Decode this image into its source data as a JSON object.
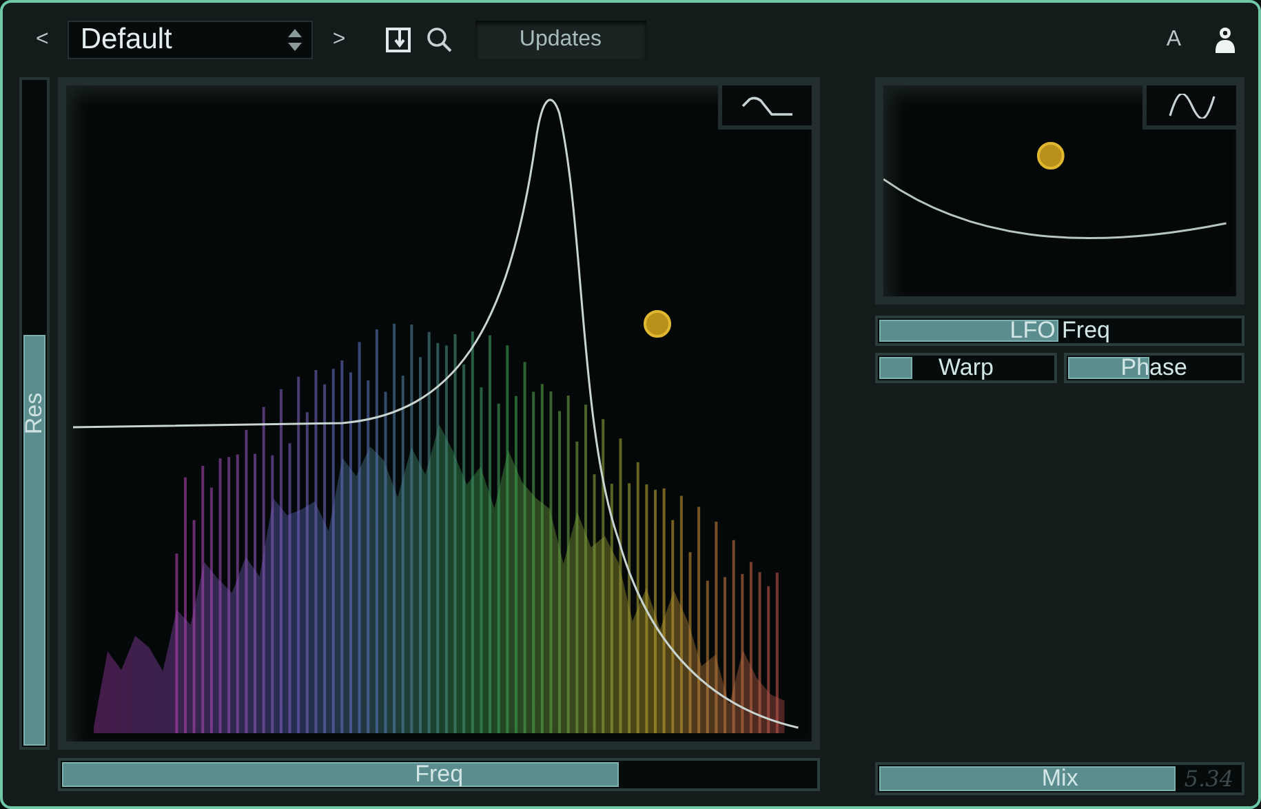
{
  "preset_bar": {
    "prev": "<",
    "name": "Default",
    "next": ">",
    "updates_button": "Updates",
    "a_label": "A"
  },
  "filter_display": {
    "res_slider": {
      "label": "Res",
      "level": 0.62
    },
    "freq_slider": {
      "label": "Freq",
      "level": 0.74
    }
  },
  "lfo_panel": {
    "lfo_freq_slider": {
      "label": "LFO Freq",
      "level": 0.5
    },
    "warp_slider": {
      "label": "Warp",
      "level": 0.2
    },
    "phase_slider": {
      "label": "Phase",
      "level": 0.48
    }
  },
  "mix_slider": {
    "label": "Mix",
    "level": 0.82,
    "value": "5.34"
  }
}
